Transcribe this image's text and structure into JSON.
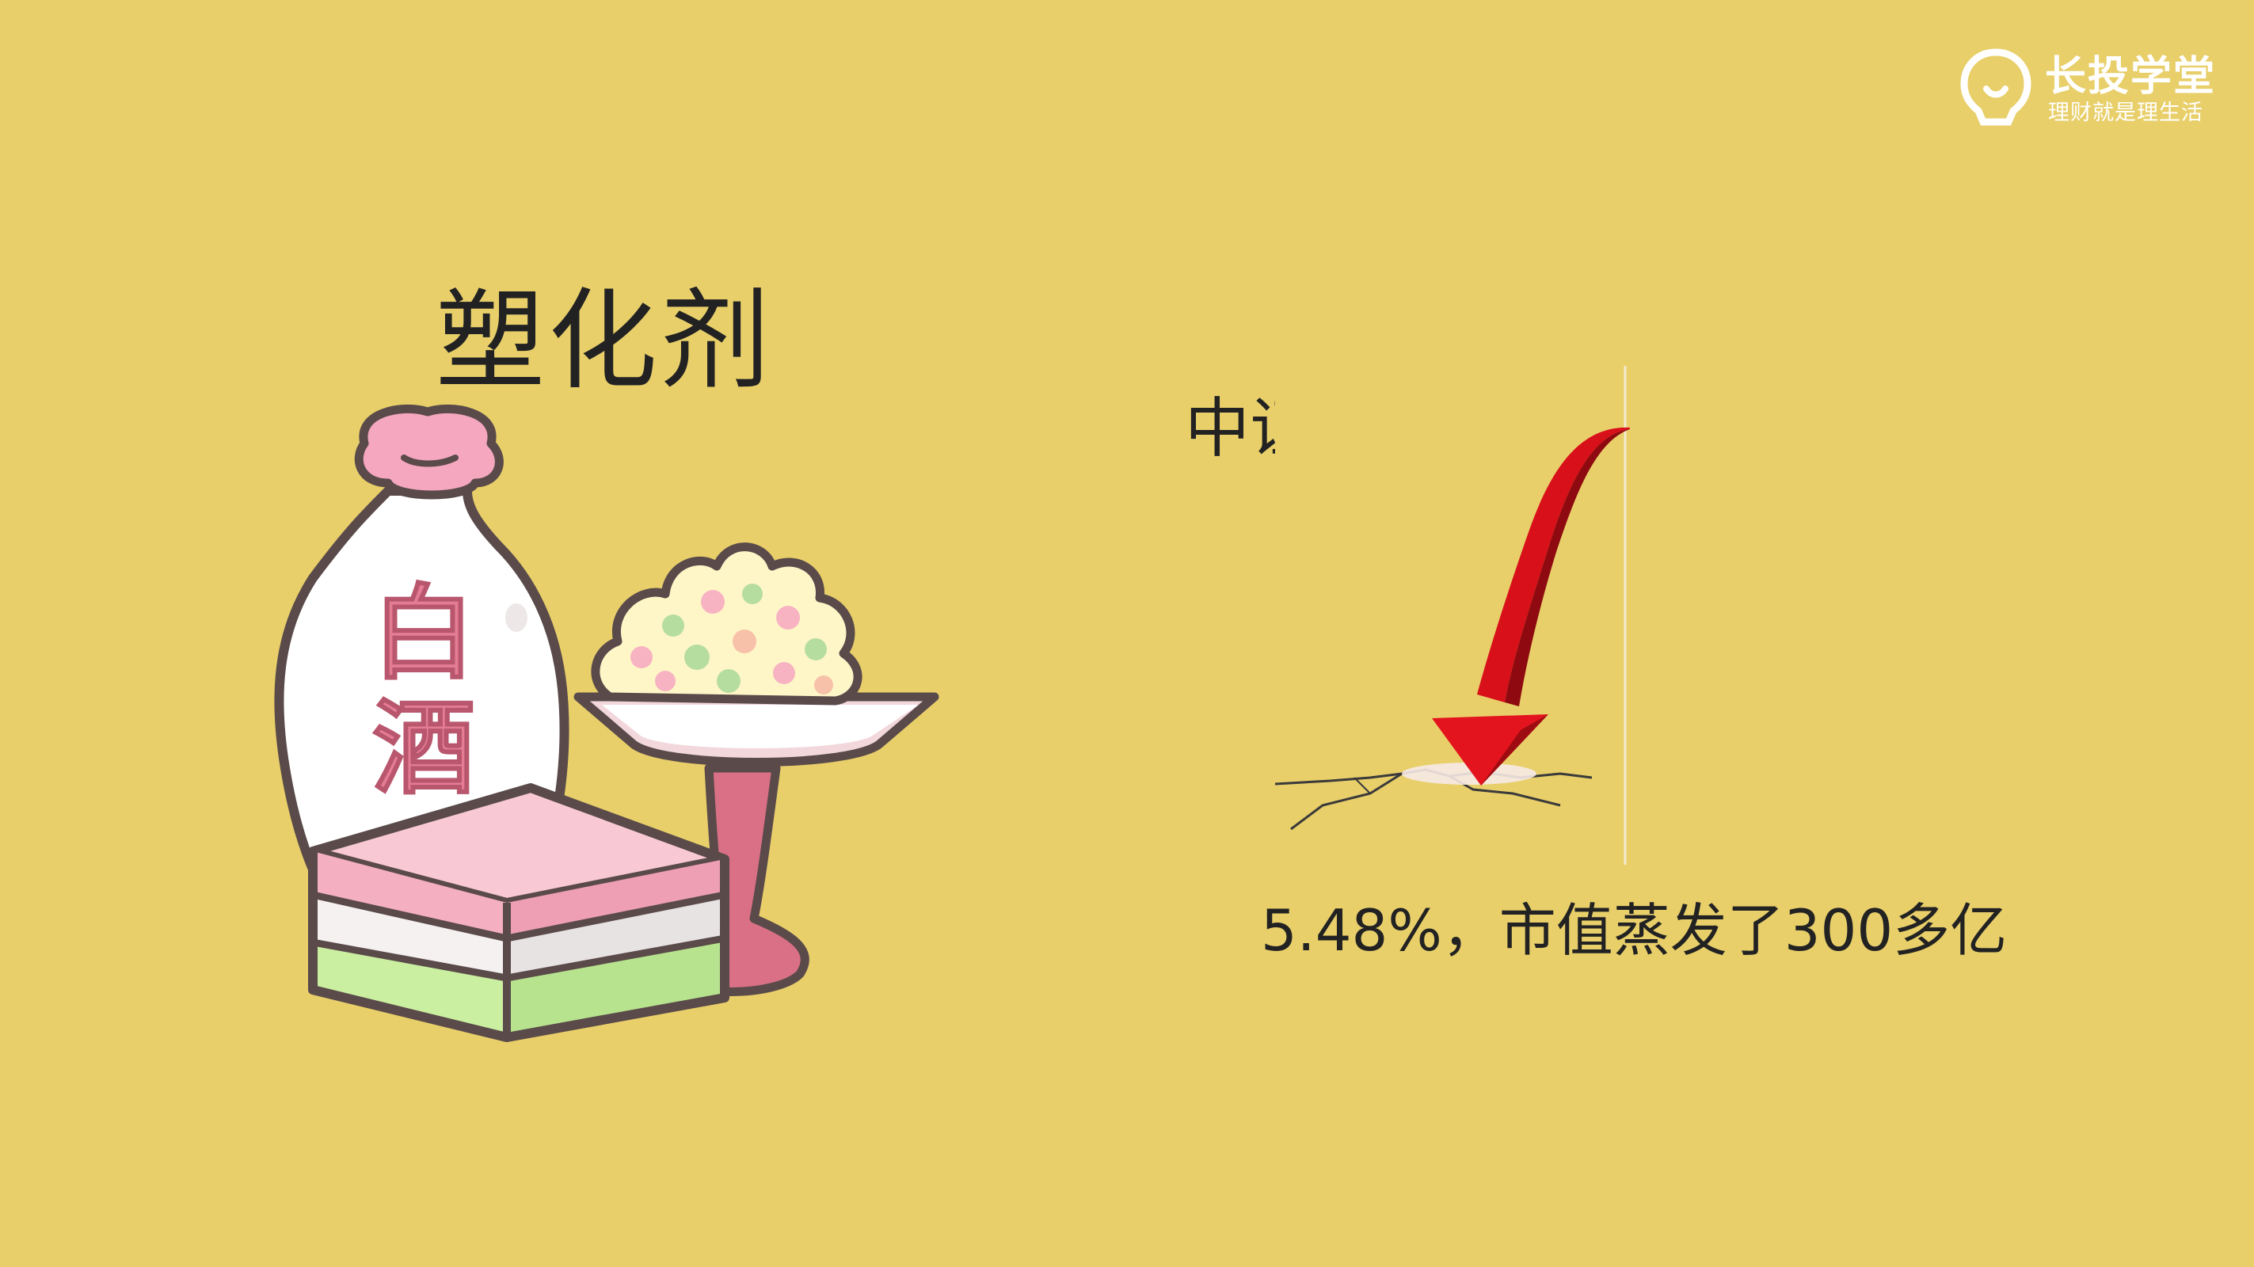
{
  "logo": {
    "title": "长投学堂",
    "subtitle": "理财就是理生活",
    "color": "#FFFFFF"
  },
  "slide": {
    "title": "塑化剂",
    "background_color": "#E8CF6A"
  },
  "illustration": {
    "bottle_label_1": "白",
    "bottle_label_2": "酒",
    "label_color": "#E47C94",
    "icons": [
      "baijiu-bottle-icon",
      "layered-cake-icon",
      "rice-dessert-bowl-icon"
    ]
  },
  "index_panel": {
    "title": "中证白酒指数",
    "stat": "5.48%，市值蒸发了300多亿",
    "arrow_color": "#D8101A",
    "icons": [
      "falling-arrow-icon",
      "ground-crack-icon"
    ]
  }
}
